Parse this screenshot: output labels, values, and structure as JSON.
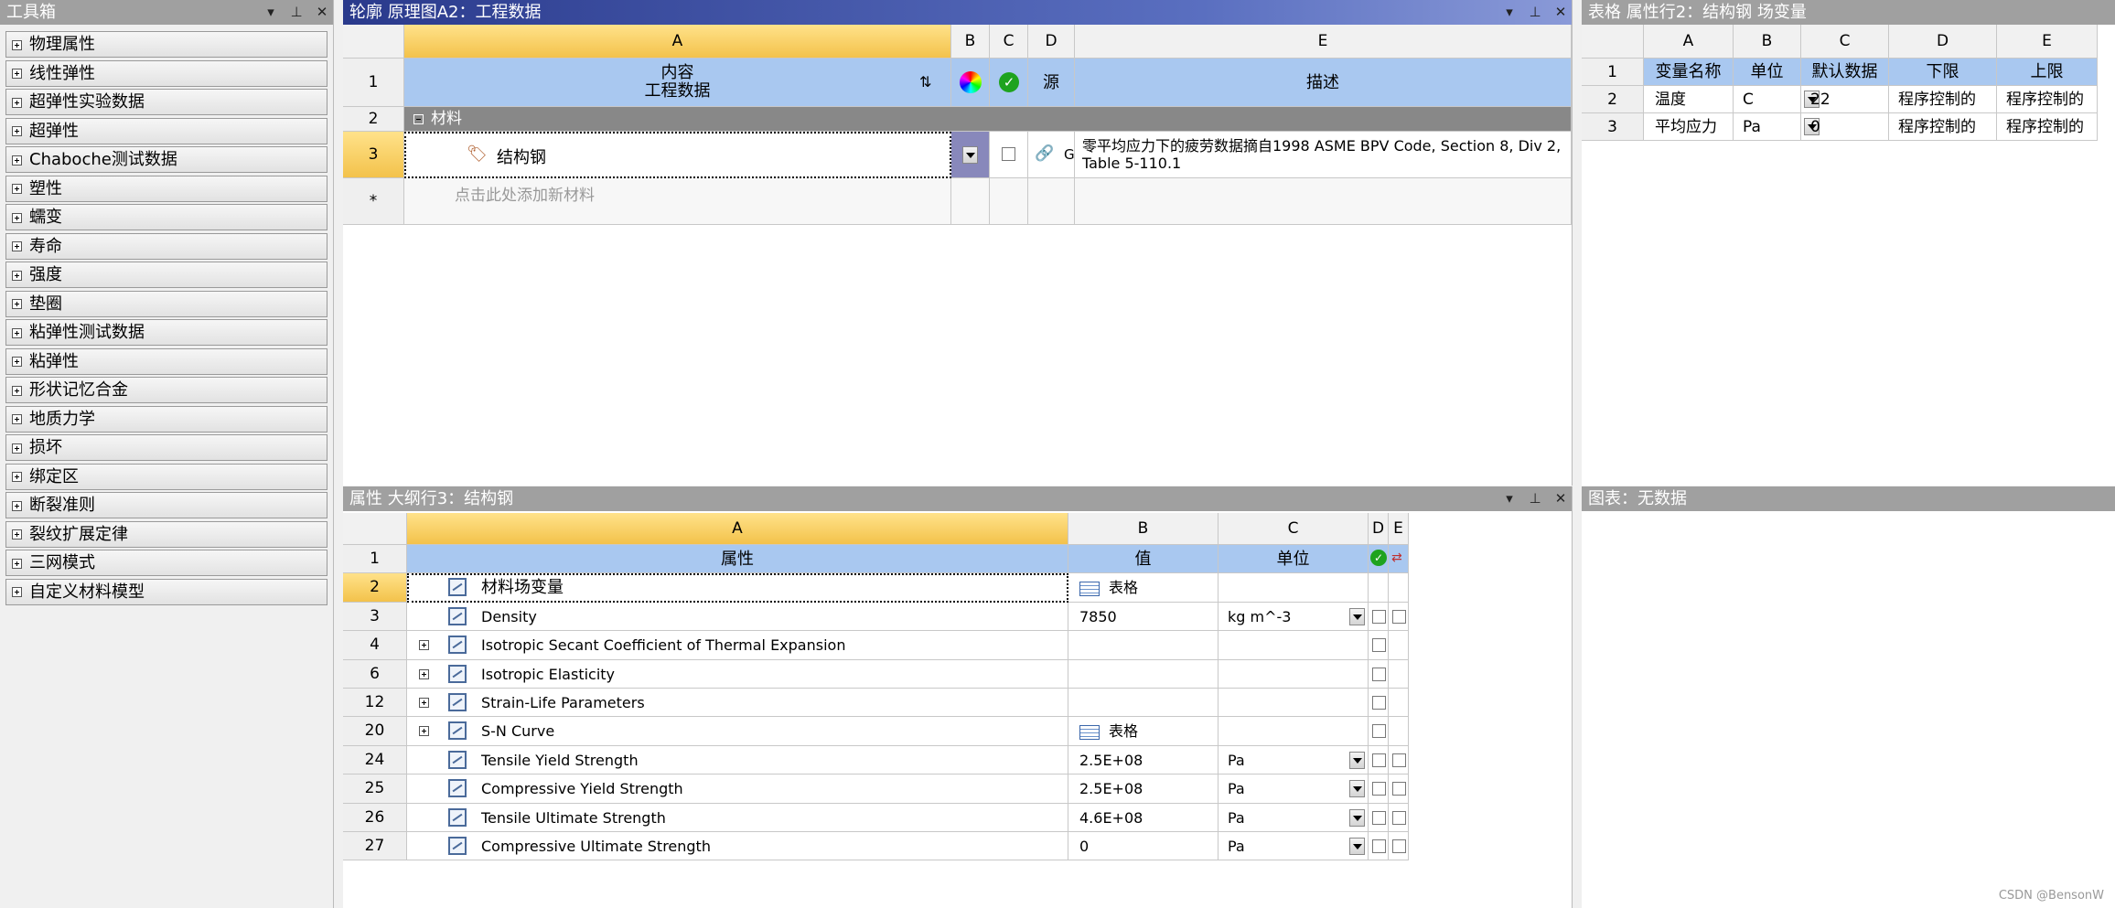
{
  "toolbox": {
    "title": "工具箱",
    "items": [
      "物理属性",
      "线性弹性",
      "超弹性实验数据",
      "超弹性",
      "Chaboche测试数据",
      "塑性",
      "蠕变",
      "寿命",
      "强度",
      "垫圈",
      "粘弹性测试数据",
      "粘弹性",
      "形状记忆合金",
      "地质力学",
      "损坏",
      "绑定区",
      "断裂准则",
      "裂纹扩展定律",
      "三网模式",
      "自定义材料模型"
    ]
  },
  "outline": {
    "title": "轮廓 原理图A2：工程数据",
    "columns": [
      "A",
      "B",
      "C",
      "D",
      "E"
    ],
    "rownums": [
      "1",
      "2",
      "3",
      "*"
    ],
    "header_content_line1": "内容",
    "header_content_line2": "工程数据",
    "header_source": "源",
    "header_desc": "描述",
    "group_label": "材料",
    "material_name": "结构钢",
    "source_short": "Ge",
    "material_desc": "零平均应力下的疲劳数据摘自1998 ASME BPV Code, Section 8, Div 2, Table 5-110.1",
    "add_new": "点击此处添加新材料"
  },
  "table": {
    "title": "表格 属性行2：结构钢 场变量",
    "columns": [
      "A",
      "B",
      "C",
      "D",
      "E"
    ],
    "rownums": [
      "1",
      "2",
      "3"
    ],
    "headers": [
      "变量名称",
      "单位",
      "默认数据",
      "下限",
      "上限"
    ],
    "rows": [
      [
        "温度",
        "C",
        "22",
        "程序控制的",
        "程序控制的"
      ],
      [
        "平均应力",
        "Pa",
        "0",
        "程序控制的",
        "程序控制的"
      ]
    ]
  },
  "properties": {
    "title": "属性 大纲行3：结构钢",
    "columns": [
      "A",
      "B",
      "C",
      "D",
      "E"
    ],
    "headers": [
      "属性",
      "值",
      "单位"
    ],
    "rows": [
      {
        "num": "1"
      },
      {
        "num": "2",
        "name": "材料场变量",
        "value": "表格",
        "unit": "",
        "expand": false,
        "tableicon": true
      },
      {
        "num": "3",
        "name": "Density",
        "value": "7850",
        "unit": "kg m^-3",
        "expand": false
      },
      {
        "num": "4",
        "name": "Isotropic Secant Coefficient of Thermal Expansion",
        "value": "",
        "unit": "",
        "expand": true
      },
      {
        "num": "6",
        "name": "Isotropic Elasticity",
        "value": "",
        "unit": "",
        "expand": true
      },
      {
        "num": "12",
        "name": "Strain-Life Parameters",
        "value": "",
        "unit": "",
        "expand": true
      },
      {
        "num": "20",
        "name": "S-N Curve",
        "value": "表格",
        "unit": "",
        "expand": true,
        "tableicon": true
      },
      {
        "num": "24",
        "name": "Tensile Yield Strength",
        "value": "2.5E+08",
        "unit": "Pa",
        "expand": false
      },
      {
        "num": "25",
        "name": "Compressive Yield Strength",
        "value": "2.5E+08",
        "unit": "Pa",
        "expand": false
      },
      {
        "num": "26",
        "name": "Tensile Ultimate Strength",
        "value": "4.6E+08",
        "unit": "Pa",
        "expand": false
      },
      {
        "num": "27",
        "name": "Compressive Ultimate Strength",
        "value": "0",
        "unit": "Pa",
        "expand": false
      }
    ]
  },
  "chart": {
    "title": "图表：无数据"
  },
  "watermark": "CSDN @BensonW"
}
